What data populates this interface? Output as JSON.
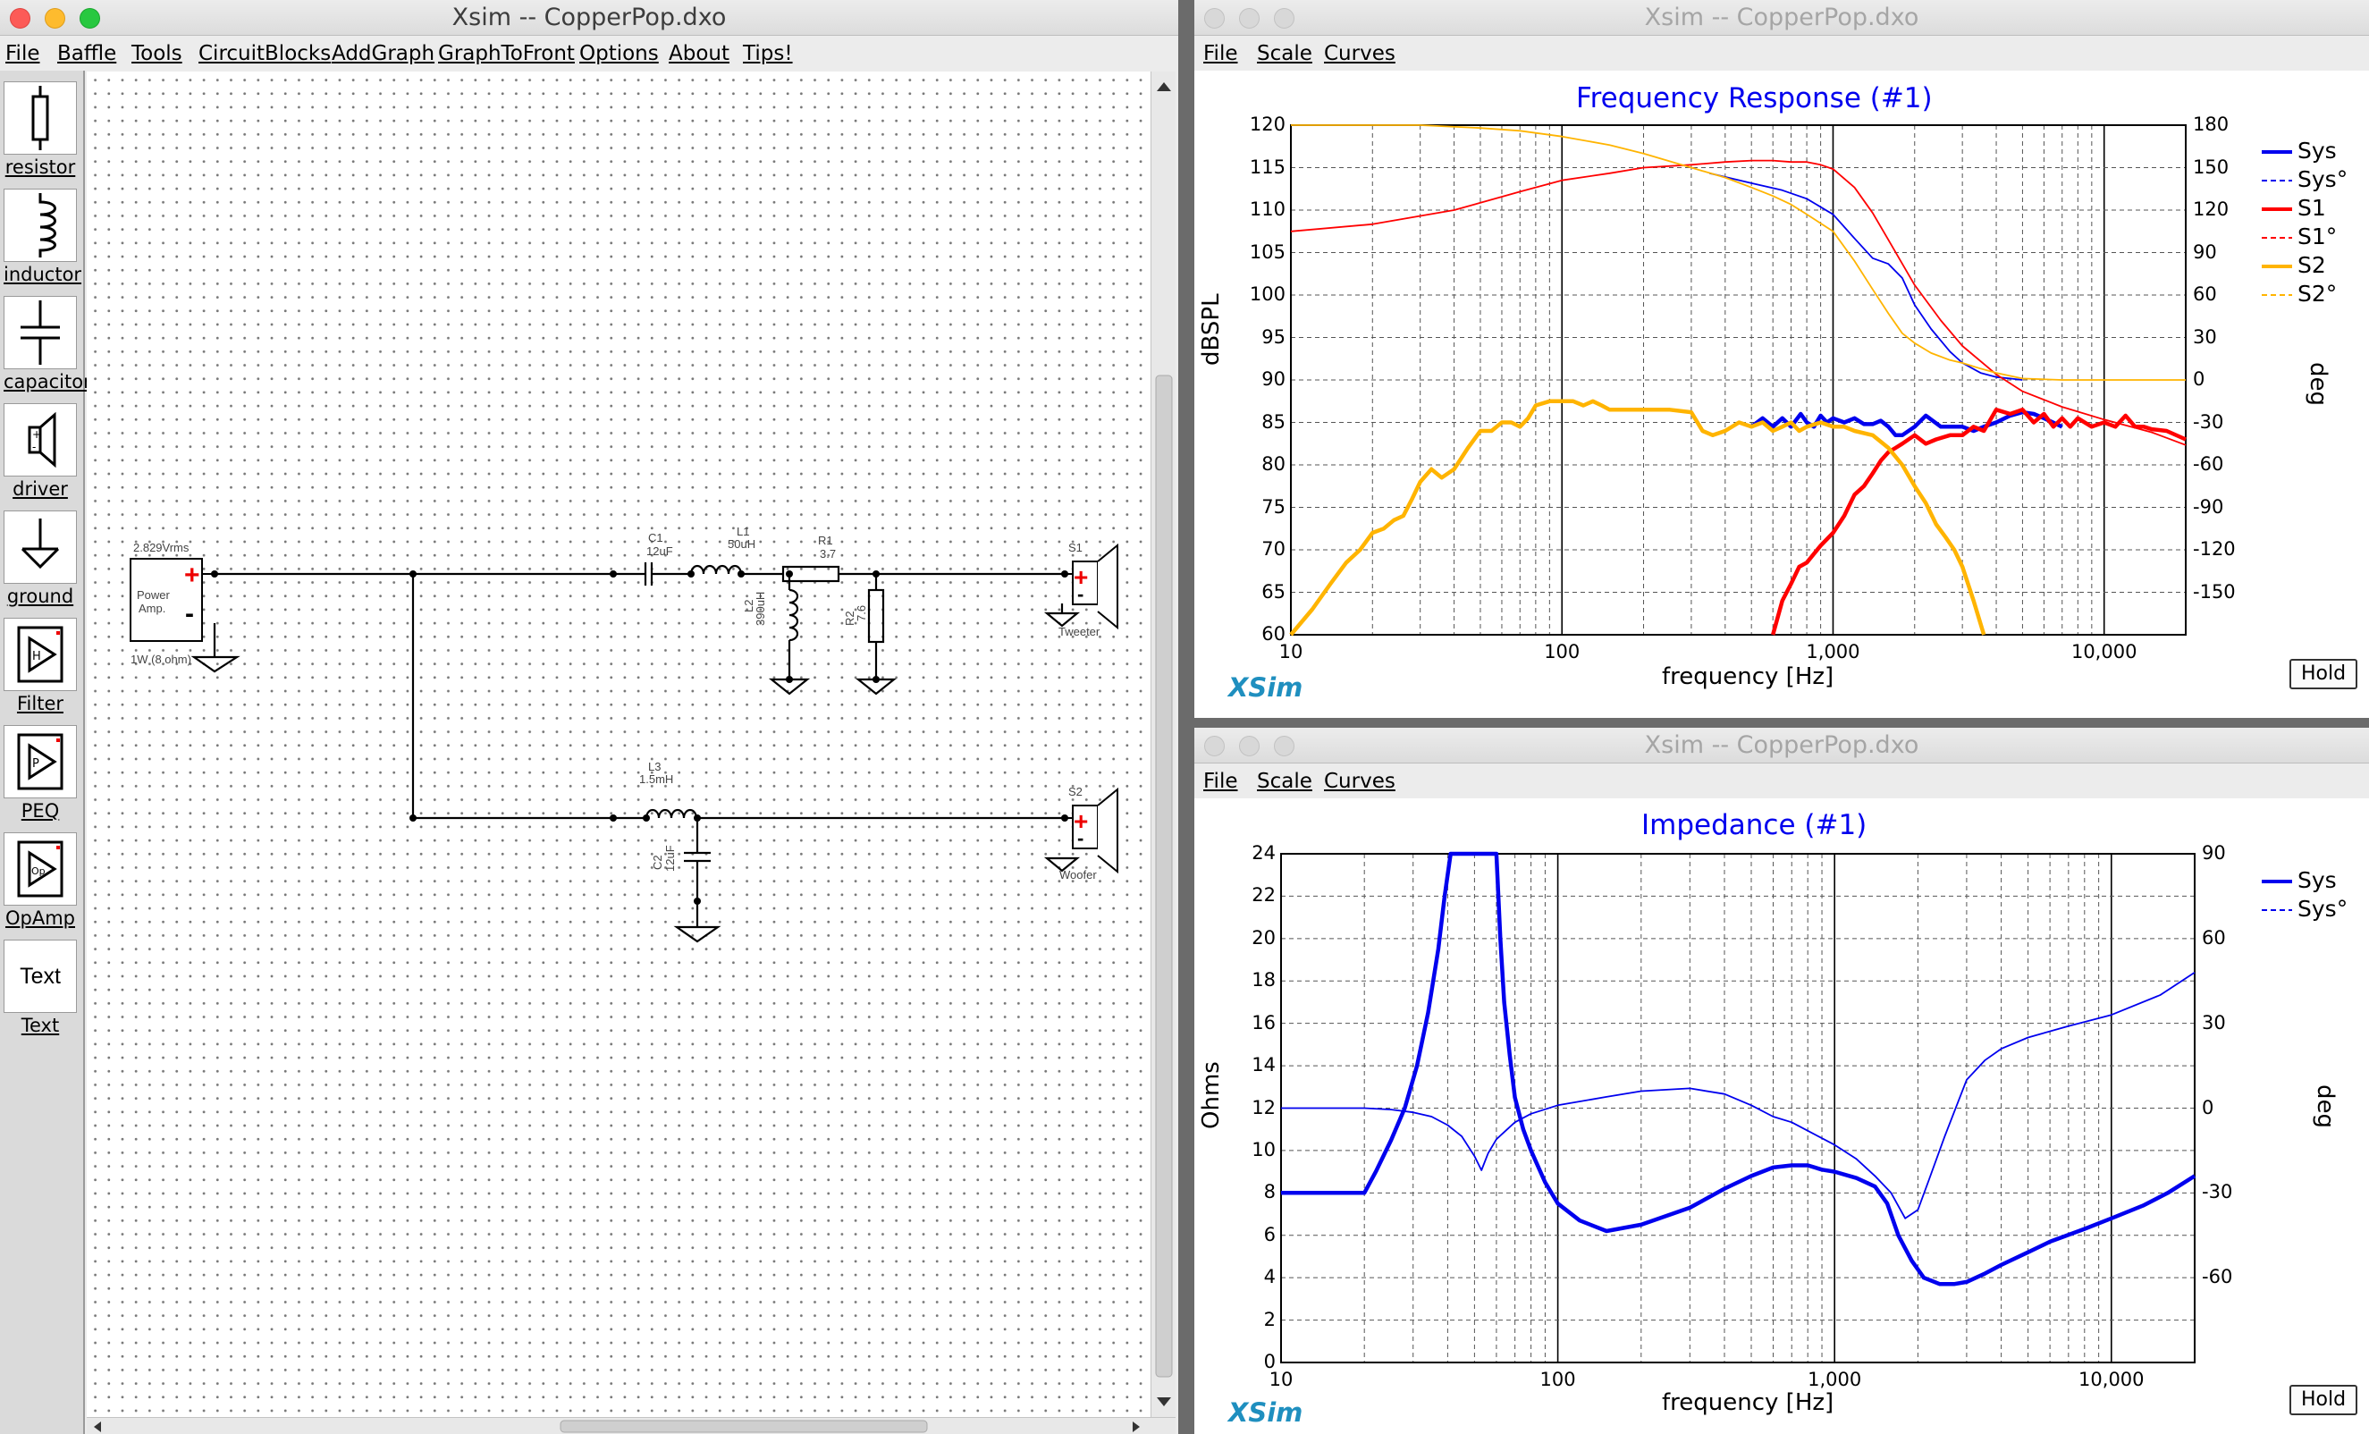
{
  "circuit_window": {
    "title": "Xsim -- CopperPop.dxo",
    "menu": [
      "File",
      "Baffle",
      "Tools",
      "CircuitBlocks",
      "AddGraph",
      "GraphToFront",
      "Options",
      "About",
      "Tips!"
    ],
    "palette": [
      {
        "label": "resistor",
        "icon": "resistor-icon"
      },
      {
        "label": "inductor",
        "icon": "inductor-icon"
      },
      {
        "label": "capacitor",
        "icon": "capacitor-icon"
      },
      {
        "label": "driver",
        "icon": "driver-icon"
      },
      {
        "label": "ground",
        "icon": "ground-icon"
      },
      {
        "label": "Filter",
        "icon": "filter-icon"
      },
      {
        "label": "PEQ",
        "icon": "peq-icon"
      },
      {
        "label": "OpAmp",
        "icon": "opamp-icon"
      },
      {
        "label": "Text",
        "icon": "text-icon",
        "box_text": "Text"
      }
    ],
    "schematic": {
      "amp": {
        "voltage": "2.829Vrms",
        "name_line1": "Power",
        "name_line2": "Amp.",
        "note": "1W (8 ohm)"
      },
      "C1": {
        "name": "C1",
        "value": "12uF"
      },
      "L1": {
        "name": "L1",
        "value": "50uH"
      },
      "R1": {
        "name": "R1",
        "value": "3.7"
      },
      "L2": {
        "name": "L2",
        "value": "390uH"
      },
      "R2": {
        "name": "R2",
        "value": "7.6"
      },
      "L3": {
        "name": "L3",
        "value": "1.5mH"
      },
      "C2": {
        "name": "C2",
        "value": "12uF"
      },
      "S1": {
        "name": "S1",
        "label": "Tweeter"
      },
      "S2": {
        "name": "S2",
        "label": "Woofer"
      }
    }
  },
  "fr_window": {
    "title": "Xsim -- CopperPop.dxo",
    "menu": [
      "File",
      "Scale",
      "Curves"
    ],
    "brand": "XSim",
    "hold_label": "Hold",
    "chart_data": {
      "type": "line",
      "title": "Frequency Response (#1)",
      "xlabel": "frequency [Hz]",
      "ylabel": "dBSPL",
      "y2label": "deg",
      "x_scale": "log",
      "xlim": [
        10,
        20000
      ],
      "ylim": [
        60,
        120
      ],
      "y2lim": [
        -180,
        180
      ],
      "x_tick_labels": [
        "10",
        "100",
        "1,000",
        "10,000"
      ],
      "y_ticks": [
        60,
        65,
        70,
        75,
        80,
        85,
        90,
        95,
        100,
        105,
        110,
        115,
        120
      ],
      "y2_ticks": [
        -150,
        -120,
        -90,
        -60,
        -30,
        0,
        30,
        60,
        90,
        120,
        150,
        180
      ],
      "grid": true,
      "legend_position": "right",
      "series": [
        {
          "name": "Sys",
          "color": "#0000ee",
          "style": "solid",
          "axis": "left",
          "x": [
            500,
            550,
            600,
            650,
            700,
            760,
            800,
            850,
            900,
            950,
            1000,
            1100,
            1200,
            1300,
            1400,
            1500,
            1600,
            1700,
            1800,
            2000,
            2200,
            2500,
            2800,
            3000,
            3300,
            3600,
            4000,
            4500,
            5000,
            5500,
            6000,
            7000
          ],
          "y": [
            84.5,
            85.5,
            84.5,
            85.5,
            84.5,
            86,
            85,
            84.5,
            85.8,
            85,
            85.5,
            85,
            85.5,
            84.8,
            84.8,
            85.2,
            84.5,
            83.5,
            83.5,
            84.5,
            85.8,
            84.5,
            84.5,
            84.5,
            84,
            84.5,
            85,
            85.8,
            86.2,
            86,
            85.5,
            84.5
          ]
        },
        {
          "name": "Sys°",
          "color": "#0000ee",
          "style": "dashed",
          "axis": "right",
          "x": [
            350,
            500,
            650,
            800,
            1000,
            1200,
            1400,
            1600,
            1800,
            2000,
            2300,
            2700,
            3000,
            3500,
            4000,
            4500,
            5000
          ],
          "y": [
            146,
            139,
            134,
            128,
            117,
            100,
            86,
            82,
            72,
            53,
            36,
            20,
            12,
            5,
            2,
            1,
            0
          ]
        },
        {
          "name": "S1",
          "color": "#ff0000",
          "style": "solid",
          "axis": "left",
          "x": [
            600,
            650,
            700,
            750,
            800,
            900,
            1000,
            1100,
            1200,
            1300,
            1400,
            1500,
            1600,
            1700,
            1800,
            2000,
            2200,
            2400,
            2700,
            3000,
            3300,
            3600,
            4000,
            4500,
            5000,
            5500,
            6000,
            6500,
            7000,
            7500,
            8000,
            9000,
            10000,
            11000,
            12000,
            13000,
            14000,
            15000,
            17000,
            20000
          ],
          "y": [
            60,
            64,
            66,
            68,
            68.5,
            70.5,
            72,
            74,
            76.5,
            77.5,
            79,
            80.5,
            81.5,
            82,
            82.5,
            83.5,
            82.5,
            83,
            83.5,
            83.5,
            84.5,
            84,
            86.5,
            86,
            86.5,
            85,
            86,
            84.5,
            85.5,
            84.5,
            85.5,
            84.5,
            85,
            84.5,
            85.8,
            84.5,
            84.5,
            84.2,
            84,
            83
          ]
        },
        {
          "name": "S1°",
          "color": "#ff0000",
          "style": "dashed",
          "axis": "right",
          "x": [
            10,
            20,
            40,
            70,
            100,
            150,
            200,
            300,
            400,
            500,
            600,
            700,
            800,
            900,
            1000,
            1200,
            1400,
            1600,
            2000,
            2500,
            3000,
            4000,
            5000,
            7000,
            10000,
            15000,
            20000
          ],
          "y": [
            105,
            110,
            120,
            133,
            141,
            146,
            150,
            152,
            154,
            155,
            155,
            154,
            154,
            152,
            149,
            136,
            118,
            99,
            67,
            42,
            24,
            4,
            -8,
            -19,
            -28,
            -37,
            -46
          ]
        },
        {
          "name": "S2",
          "color": "#ffb400",
          "style": "solid",
          "axis": "left",
          "x": [
            10,
            12,
            14,
            16,
            18,
            20,
            22,
            24,
            26,
            28,
            30,
            33,
            36,
            40,
            45,
            50,
            55,
            60,
            65,
            70,
            75,
            80,
            90,
            100,
            110,
            120,
            130,
            140,
            150,
            170,
            200,
            250,
            300,
            330,
            360,
            400,
            450,
            500,
            550,
            600,
            650,
            700,
            750,
            800,
            900,
            1000,
            1100,
            1200,
            1400,
            1600,
            1800,
            2000,
            2200,
            2400,
            2600,
            2800,
            3000,
            3300,
            3600
          ],
          "y": [
            60,
            63,
            66,
            68.5,
            70,
            72,
            72.5,
            73.5,
            74,
            76,
            78,
            79.5,
            78.5,
            79.5,
            82,
            84,
            84,
            85,
            85,
            84.5,
            85.5,
            87,
            87.5,
            87.5,
            87.5,
            87,
            87.5,
            87,
            86.5,
            86.5,
            86.5,
            86.5,
            86.2,
            84,
            83.5,
            84,
            85,
            84.5,
            85,
            84,
            84.5,
            85,
            84,
            84.5,
            85,
            84.5,
            84.5,
            84,
            83.5,
            82,
            80,
            77.5,
            75.5,
            73,
            71.5,
            70,
            68,
            64,
            60
          ]
        },
        {
          "name": "S2°",
          "color": "#ffb400",
          "style": "dashed",
          "axis": "right",
          "x": [
            10,
            30,
            50,
            70,
            100,
            150,
            200,
            300,
            400,
            500,
            600,
            700,
            800,
            1000,
            1200,
            1400,
            1600,
            1800,
            2000,
            2300,
            2700,
            3000,
            3500,
            4000,
            5000,
            7000,
            10000,
            20000
          ],
          "y": [
            180,
            180,
            178,
            176,
            172,
            166,
            160,
            150,
            143,
            136,
            130,
            124,
            117,
            105,
            84,
            64,
            47,
            33,
            26,
            19,
            14,
            12,
            8,
            5,
            1,
            0,
            0,
            0
          ]
        }
      ]
    }
  },
  "imp_window": {
    "title": "Xsim -- CopperPop.dxo",
    "menu": [
      "File",
      "Scale",
      "Curves"
    ],
    "brand": "XSim",
    "hold_label": "Hold",
    "chart_data": {
      "type": "line",
      "title": "Impedance (#1)",
      "xlabel": "frequency [Hz]",
      "ylabel": "Ohms",
      "y2label": "deg",
      "x_scale": "log",
      "xlim": [
        10,
        20000
      ],
      "ylim": [
        0,
        24
      ],
      "y2lim": [
        -90,
        90
      ],
      "x_tick_labels": [
        "10",
        "100",
        "1,000",
        "10,000"
      ],
      "y_ticks": [
        0,
        2,
        4,
        6,
        8,
        10,
        12,
        14,
        16,
        18,
        20,
        22,
        24
      ],
      "y2_ticks": [
        -60,
        -30,
        0,
        30,
        60,
        90
      ],
      "grid": true,
      "legend_position": "right",
      "series": [
        {
          "name": "Sys",
          "color": "#0000ee",
          "style": "solid",
          "axis": "left",
          "x": [
            10,
            20,
            22,
            25,
            28,
            31,
            34,
            37,
            39,
            41,
            42,
            60,
            62,
            64,
            67,
            70,
            75,
            80,
            90,
            100,
            120,
            150,
            200,
            300,
            400,
            500,
            600,
            700,
            800,
            900,
            1000,
            1200,
            1400,
            1550,
            1700,
            1900,
            2100,
            2400,
            2700,
            3000,
            3500,
            4000,
            5000,
            6000,
            8000,
            10000,
            13000,
            16000,
            20000
          ],
          "y": [
            8,
            8,
            9,
            10.5,
            12,
            14,
            16.5,
            19.5,
            22,
            24,
            24,
            24,
            20,
            17,
            14.5,
            12.5,
            11,
            10,
            8.5,
            7.5,
            6.7,
            6.2,
            6.5,
            7.3,
            8.2,
            8.8,
            9.2,
            9.3,
            9.3,
            9.1,
            9,
            8.7,
            8.3,
            7.5,
            6,
            4.8,
            4,
            3.7,
            3.7,
            3.8,
            4.2,
            4.6,
            5.2,
            5.7,
            6.3,
            6.8,
            7.4,
            8,
            8.8
          ]
        },
        {
          "name": "Sys°",
          "color": "#0000ee",
          "style": "dashed",
          "axis": "right",
          "x": [
            10,
            20,
            25,
            30,
            35,
            40,
            45,
            50,
            53,
            56,
            60,
            70,
            80,
            100,
            150,
            200,
            300,
            400,
            500,
            600,
            700,
            800,
            1000,
            1200,
            1400,
            1600,
            1800,
            2000,
            2200,
            2500,
            3000,
            3500,
            4000,
            5000,
            7000,
            10000,
            15000,
            20000
          ],
          "y": [
            0,
            0,
            -0.5,
            -1.5,
            -3,
            -6,
            -10,
            -17,
            -22,
            -16,
            -11,
            -5,
            -2,
            1,
            4,
            6,
            7,
            5,
            1,
            -3,
            -5,
            -8,
            -13,
            -18,
            -24,
            -30,
            -39,
            -36,
            -25,
            -10,
            10,
            17,
            21,
            25,
            29,
            33,
            40,
            48
          ]
        }
      ]
    }
  }
}
